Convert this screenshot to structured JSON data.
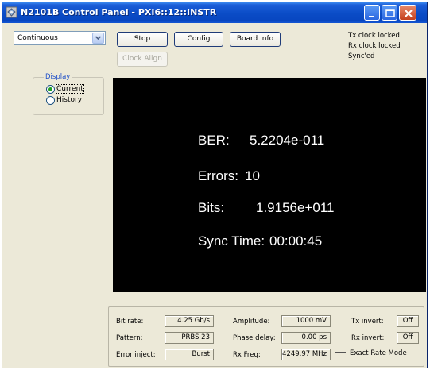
{
  "window": {
    "title": "N2101B Control Panel - PXI6::12::INSTR"
  },
  "mode_select": {
    "value": "Continuous"
  },
  "toolbar": {
    "stop_label": "Stop",
    "config_label": "Config",
    "board_info_label": "Board Info",
    "clock_align_label": "Clock Align"
  },
  "status": {
    "tx_clock": "Tx clock locked",
    "rx_clock": "Rx clock locked",
    "sync": "Sync'ed"
  },
  "display_group": {
    "label": "Display",
    "options": [
      "Current",
      "History"
    ],
    "selected": "Current"
  },
  "readout": {
    "ber_label": "BER:",
    "ber_value": "5.2204e-011",
    "errors_label": "Errors:",
    "errors_value": "10",
    "bits_label": "Bits:",
    "bits_value": "1.9156e+011",
    "sync_label": "Sync Time:",
    "sync_value": "00:00:45"
  },
  "fields": {
    "bit_rate_label": "Bit rate:",
    "bit_rate_value": "4.25 Gb/s",
    "pattern_label": "Pattern:",
    "pattern_value": "PRBS 23",
    "error_inject_label": "Error inject:",
    "error_inject_value": "Burst",
    "amplitude_label": "Amplitude:",
    "amplitude_value": "1000 mV",
    "phase_delay_label": "Phase delay:",
    "phase_delay_value": "0.00 ps",
    "rx_freq_label": "Rx Freq:",
    "rx_freq_value": "4249.97 MHz",
    "tx_invert_label": "Tx invert:",
    "tx_invert_value": "Off",
    "rx_invert_label": "Rx invert:",
    "rx_invert_value": "Off",
    "rate_mode": "Exact Rate Mode"
  },
  "icons": {
    "app": "app-icon",
    "minimize": "minimize-icon",
    "maximize": "maximize-icon",
    "close": "close-icon",
    "dropdown": "chevron-down-icon"
  }
}
